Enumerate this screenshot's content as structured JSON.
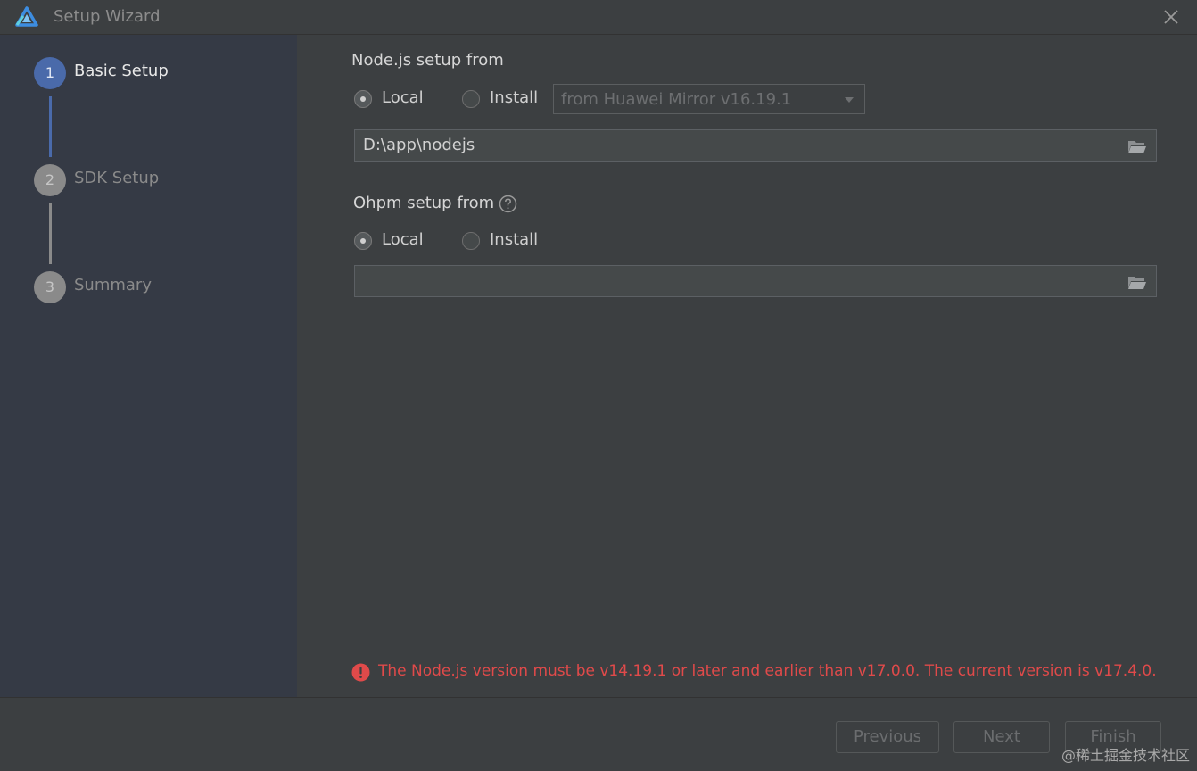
{
  "window": {
    "title": "Setup Wizard"
  },
  "sidebar": {
    "steps": [
      {
        "number": "1",
        "label": "Basic Setup",
        "state": "active"
      },
      {
        "number": "2",
        "label": "SDK Setup",
        "state": "inactive"
      },
      {
        "number": "3",
        "label": "Summary",
        "state": "inactive"
      }
    ]
  },
  "nodejs": {
    "title": "Node.js setup from",
    "local_label": "Local",
    "install_label": "Install",
    "selected": "Local",
    "mirror_selected": "from Huawei Mirror v16.19.1",
    "path_value": "D:\\app\\nodejs"
  },
  "ohpm": {
    "title": "Ohpm setup from",
    "local_label": "Local",
    "install_label": "Install",
    "selected": "Local",
    "path_value": ""
  },
  "error": {
    "message": "The Node.js version must be v14.19.1 or later and earlier than v17.0.0. The current version is v17.4.0."
  },
  "footer": {
    "previous_label": "Previous",
    "next_label": "Next",
    "finish_label": "Finish"
  },
  "watermark": "@稀土掘金技术社区",
  "colors": {
    "active_step": "#4a6aaa",
    "error": "#e04a4a",
    "sidebar_bg": "#353a45",
    "window_bg": "#3c3f41"
  },
  "icons": {
    "app": "deveco-logo-icon",
    "close": "close-icon",
    "folder": "folder-open-icon",
    "help": "help-circle-icon",
    "error": "error-circle-icon",
    "dropdown": "chevron-down-icon"
  }
}
